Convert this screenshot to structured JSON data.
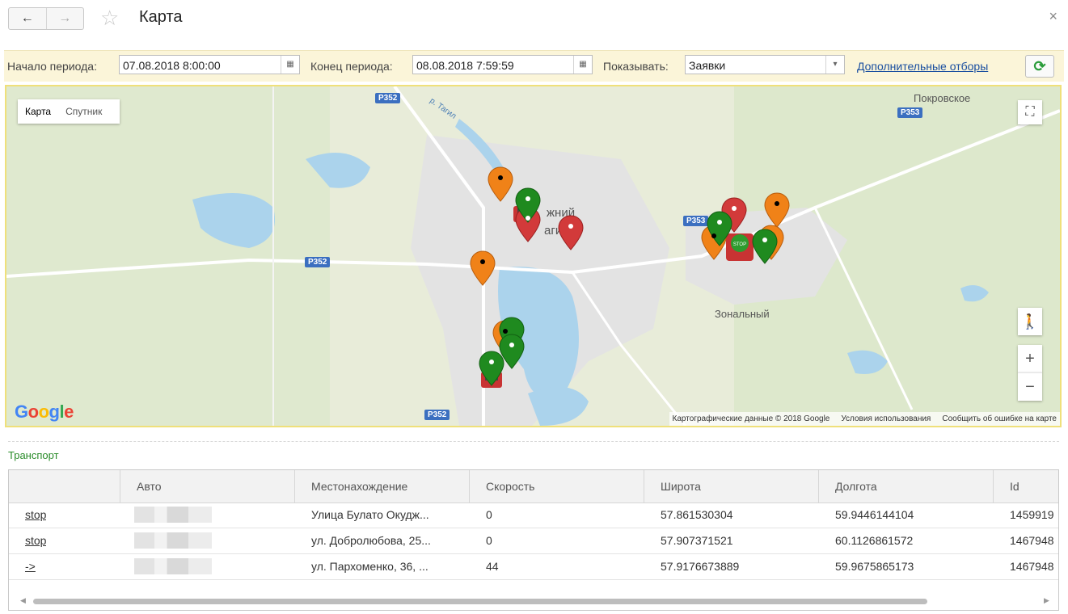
{
  "window": {
    "title": "Карта",
    "back_glyph": "←",
    "forward_glyph": "→",
    "favorite_glyph": "☆",
    "close_glyph": "×"
  },
  "filter": {
    "start_label": "Начало периода:",
    "start_value": "07.08.2018  8:00:00",
    "end_label": "Конец периода:",
    "end_value": "08.08.2018  7:59:59",
    "show_label": "Показывать:",
    "show_value": "Заявки",
    "extra_filters_link": "Дополнительные отборы",
    "refresh_glyph": "C"
  },
  "map": {
    "type_map": "Карта",
    "type_satellite": "Спутник",
    "places": [
      "Покровское",
      "жний",
      "агил",
      "Зональный",
      "р. Тагил"
    ],
    "roads": [
      "Р352",
      "Р353",
      "Р352",
      "Р353",
      "Р352"
    ],
    "google_logo": "Google",
    "attribution": {
      "data": "Картографические данные © 2018 Google",
      "terms": "Условия использования",
      "report": "Сообщить об ошибке на карте"
    },
    "zoom_in": "+",
    "zoom_out": "−",
    "colors": {
      "orange": "#f08218",
      "red": "#d23a3a",
      "green": "#1f8a1f"
    }
  },
  "transport": {
    "section_title": "Транспорт",
    "columns": [
      "",
      "Авто",
      "Местонахождение",
      "Скорость",
      "Широта",
      "Долгота",
      "Id"
    ],
    "rows": [
      {
        "action": "stop",
        "location": "Улица Булато Окудж...",
        "speed": "0",
        "lat": "57.861530304",
        "lon": "59.9446144104",
        "id": "1459919"
      },
      {
        "action": "stop",
        "location": "ул. Добролюбова, 25...",
        "speed": "0",
        "lat": "57.907371521",
        "lon": "60.1126861572",
        "id": "1467948"
      },
      {
        "action": "->",
        "location": "ул. Пархоменко, 36, ...",
        "speed": "44",
        "lat": "57.9176673889",
        "lon": "59.9675865173",
        "id": "1467948"
      }
    ]
  }
}
